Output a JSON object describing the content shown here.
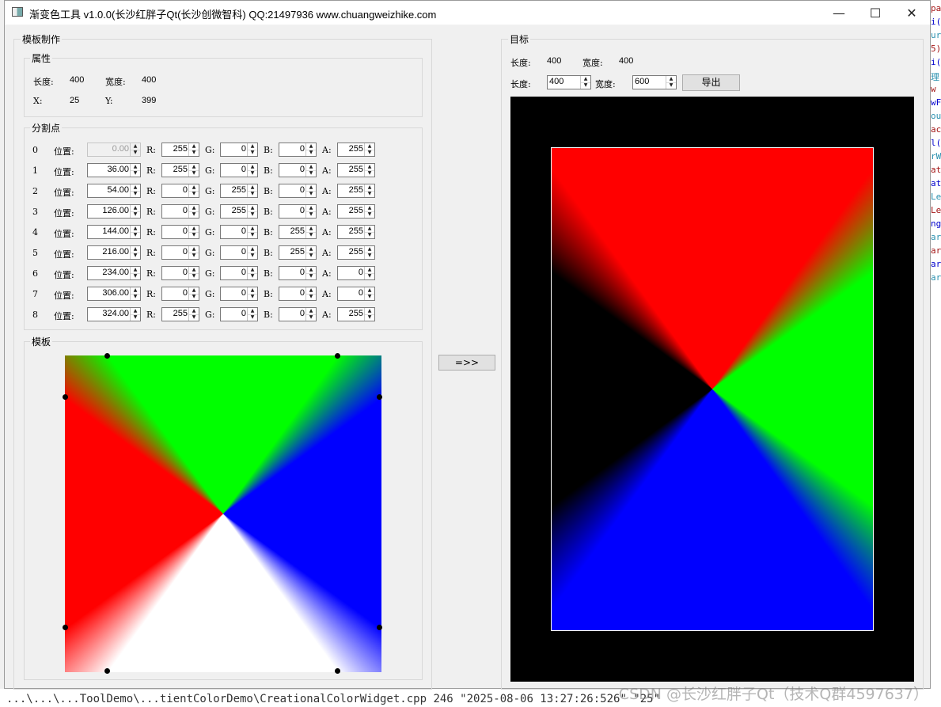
{
  "window": {
    "title": "渐变色工具 v1.0.0(长沙红胖子Qt(长沙创微智科) QQ:21497936 www.chuangweizhike.com",
    "minimize": "—",
    "maximize": "☐",
    "close": "✕"
  },
  "template_panel": {
    "title": "模板制作",
    "props": {
      "title": "属性",
      "length_label": "长度:",
      "length_value": "400",
      "width_label": "宽度:",
      "width_value": "400",
      "x_label": "X:",
      "x_value": "25",
      "y_label": "Y:",
      "y_value": "399"
    },
    "split": {
      "title": "分割点",
      "position_label": "位置:",
      "r_label": "R:",
      "g_label": "G:",
      "b_label": "B:",
      "a_label": "A:",
      "rows": [
        {
          "index": "0",
          "pos": "0.00",
          "r": "255",
          "g": "0",
          "b": "0",
          "a": "255"
        },
        {
          "index": "1",
          "pos": "36.00",
          "r": "255",
          "g": "0",
          "b": "0",
          "a": "255"
        },
        {
          "index": "2",
          "pos": "54.00",
          "r": "0",
          "g": "255",
          "b": "0",
          "a": "255"
        },
        {
          "index": "3",
          "pos": "126.00",
          "r": "0",
          "g": "255",
          "b": "0",
          "a": "255"
        },
        {
          "index": "4",
          "pos": "144.00",
          "r": "0",
          "g": "0",
          "b": "255",
          "a": "255"
        },
        {
          "index": "5",
          "pos": "216.00",
          "r": "0",
          "g": "0",
          "b": "255",
          "a": "255"
        },
        {
          "index": "6",
          "pos": "234.00",
          "r": "0",
          "g": "0",
          "b": "0",
          "a": "0"
        },
        {
          "index": "7",
          "pos": "306.00",
          "r": "0",
          "g": "0",
          "b": "0",
          "a": "0"
        },
        {
          "index": "8",
          "pos": "324.00",
          "r": "255",
          "g": "0",
          "b": "0",
          "a": "255"
        }
      ]
    },
    "template": {
      "title": "模板"
    }
  },
  "convert_button": "=>>",
  "target_panel": {
    "title": "目标",
    "length_label": "长度:",
    "length_value": "400",
    "width_label": "宽度:",
    "width_value": "400",
    "length_input_label": "长度:",
    "length_input": "400",
    "width_input_label": "宽度:",
    "width_input": "600",
    "export_button": "导出"
  },
  "background": {
    "bottom_text": "...\\...\\...ToolDemo\\...tientColorDemo\\CreationalColorWidget.cpp 246 \"2025-08-06 13:27:26:526\" \"25\"",
    "right_fragments": [
      "pa",
      "i(",
      "ur",
      "5)",
      "i(",
      "理",
      "w",
      "wF",
      "ou",
      "ac",
      "l(",
      "rW",
      "at",
      "at",
      "Le",
      "Le",
      "ng",
      "ar",
      "ar",
      "ar",
      "ar"
    ]
  },
  "watermark": "CSDN @长沙红胖子Qt（技术Q群4597637）"
}
